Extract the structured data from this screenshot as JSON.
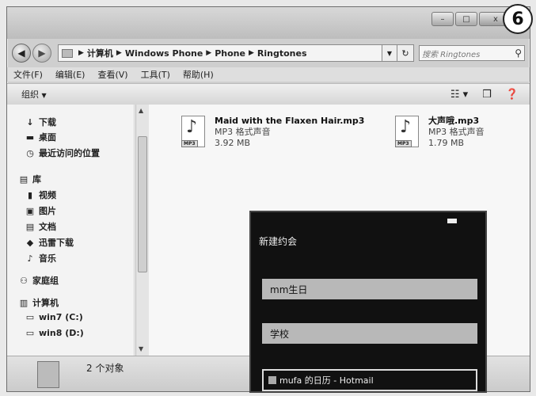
{
  "callout_number": "6",
  "titlebar": {
    "minimize": "–",
    "maximize": "□",
    "close": "x"
  },
  "address": {
    "crumbs": [
      "计算机",
      "Windows Phone",
      "Phone",
      "Ringtones"
    ],
    "search_placeholder": "搜索 Ringtones"
  },
  "menu": [
    "文件(F)",
    "编辑(E)",
    "查看(V)",
    "工具(T)",
    "帮助(H)"
  ],
  "toolbar": {
    "organize": "组织"
  },
  "sidebar": {
    "items": [
      {
        "label": "下载",
        "icon": "↓"
      },
      {
        "label": "桌面",
        "icon": "▬"
      },
      {
        "label": "最近访问的位置",
        "icon": "◷"
      },
      {
        "label": "库",
        "icon": "▤"
      },
      {
        "label": "视频",
        "icon": "▮"
      },
      {
        "label": "图片",
        "icon": "▣"
      },
      {
        "label": "文档",
        "icon": "▤"
      },
      {
        "label": "迅雷下载",
        "icon": "◆"
      },
      {
        "label": "音乐",
        "icon": "♪"
      },
      {
        "label": "家庭组",
        "icon": "⚇"
      },
      {
        "label": "计算机",
        "icon": "▥"
      },
      {
        "label": "win7 (C:)",
        "icon": "▭"
      },
      {
        "label": "win8 (D:)",
        "icon": "▭"
      }
    ]
  },
  "files": [
    {
      "name": "Maid with the Flaxen Hair.mp3",
      "type": "MP3 格式声音",
      "size": "3.92 MB",
      "tag": "MP3"
    },
    {
      "name": "大声哦.mp3",
      "type": "MP3 格式声音",
      "size": "1.79 MB",
      "tag": "MP3"
    }
  ],
  "phone": {
    "title": "新建约会",
    "subject": "mm生日",
    "location": "学校",
    "calendar": "mufa 的日历 - Hotmail"
  },
  "status": {
    "count": "2 个对象"
  }
}
